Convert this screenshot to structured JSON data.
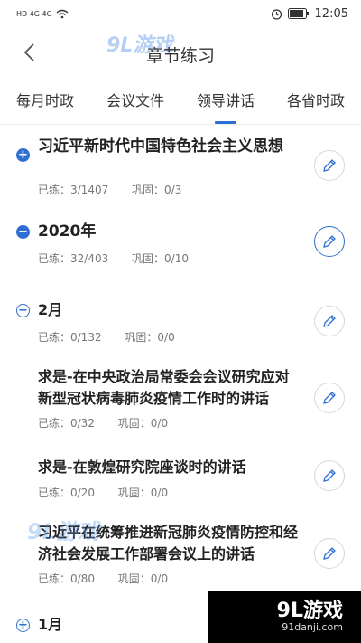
{
  "status_bar": {
    "left_text": "HD 4G 4G",
    "battery_text": "",
    "time": "12:05"
  },
  "header": {
    "title": "章节练习",
    "watermark": "9L游戏"
  },
  "tabs": [
    {
      "label": "每月时政",
      "active": false
    },
    {
      "label": "会议文件",
      "active": false
    },
    {
      "label": "领导讲话",
      "active": true
    },
    {
      "label": "各省时政",
      "active": false
    }
  ],
  "items": [
    {
      "toggle": "+",
      "style": "filled",
      "title": "习近平新时代中国特色社会主义思想",
      "practiced": "已练：3/1407",
      "consolidated": "巩固：0/3"
    },
    {
      "toggle": "−",
      "style": "filled",
      "title": "2020年",
      "practiced": "已练：32/403",
      "consolidated": "巩固：0/10"
    },
    {
      "toggle": "−",
      "style": "outline",
      "title": "2月",
      "practiced": "已练：0/132",
      "consolidated": "巩固：0/0"
    },
    {
      "toggle": "",
      "style": "none",
      "title": "求是-在中央政治局常委会会议研究应对新型冠状病毒肺炎疫情工作时的讲话",
      "practiced": "已练：0/32",
      "consolidated": "巩固：0/0"
    },
    {
      "toggle": "",
      "style": "none",
      "title": "求是-在敦煌研究院座谈时的讲话",
      "practiced": "已练：0/20",
      "consolidated": "巩固：0/0"
    },
    {
      "toggle": "",
      "style": "none",
      "title": "习近平在统筹推进新冠肺炎疫情防控和经济社会发展工作部署会议上的讲话",
      "practiced": "已练：0/80",
      "consolidated": "巩固：0/0"
    },
    {
      "toggle": "+",
      "style": "outline",
      "title": "1月",
      "practiced": "",
      "consolidated": ""
    }
  ],
  "watermark_badge": {
    "logo": "9L游戏",
    "url": "91danji.com"
  },
  "colors": {
    "accent": "#2f6fd3"
  }
}
